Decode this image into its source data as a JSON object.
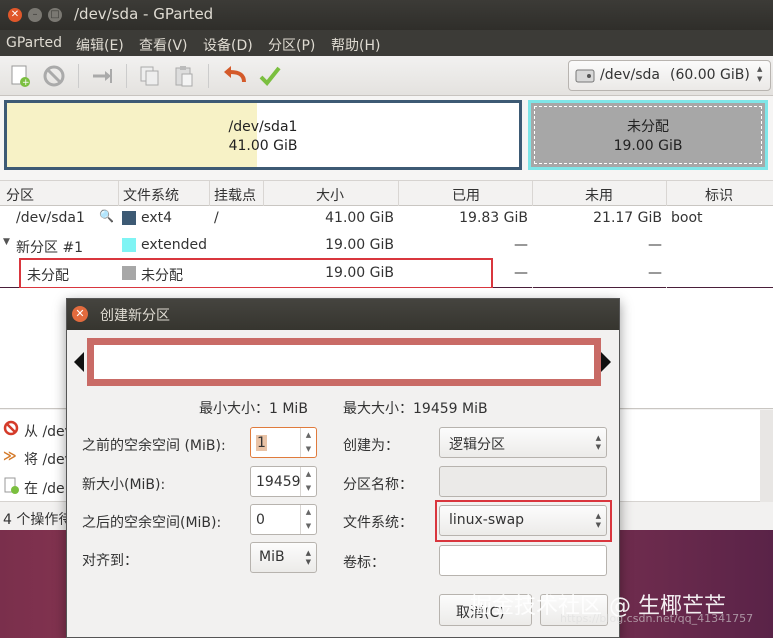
{
  "window": {
    "title": "/dev/sda - GParted"
  },
  "menubar": [
    "GParted",
    "编辑(E)",
    "查看(V)",
    "设备(D)",
    "分区(P)",
    "帮助(H)"
  ],
  "toolbar": {
    "new": "new-partition-icon",
    "delete": "delete-icon",
    "resize": "resize-icon",
    "copy": "copy-icon",
    "paste": "paste-icon",
    "undo": "undo-icon",
    "apply": "apply-icon"
  },
  "device_selector": {
    "label": "/dev/sda",
    "size": "(60.00 GiB)"
  },
  "graph": {
    "seg1_name": "/dev/sda1",
    "seg1_size": "41.00 GiB",
    "seg2_name": "未分配",
    "seg2_size": "19.00 GiB"
  },
  "table": {
    "headers": [
      "分区",
      "文件系统",
      "挂载点",
      "大小",
      "已用",
      "未用",
      "标识"
    ],
    "rows": [
      {
        "partition": "/dev/sda1",
        "fs": "ext4",
        "mount": "/",
        "size": "41.00 GiB",
        "used": "19.83 GiB",
        "unused": "21.17 GiB",
        "flags": "boot",
        "color": "#3d5a74"
      },
      {
        "partition": "新分区 #1",
        "fs": "extended",
        "mount": "",
        "size": "19.00 GiB",
        "used": "—",
        "unused": "—",
        "flags": "",
        "color": "#7ff4f4"
      },
      {
        "partition": "未分配",
        "fs": "未分配",
        "mount": "",
        "size": "19.00 GiB",
        "used": "—",
        "unused": "—",
        "flags": "",
        "color": "#a7a7a7"
      }
    ]
  },
  "ops_log": {
    "items": [
      "从 /dev",
      "将 /dev",
      "在 /de"
    ],
    "pending": "4 个操作待"
  },
  "dialog": {
    "title": "创建新分区",
    "min_size": "最小大小：1 MiB",
    "max_size": "最大大小：19459 MiB",
    "free_before_label": "之前的空余空间 (MiB):",
    "free_before_value": "1",
    "new_size_label": "新大小(MiB):",
    "new_size_value": "19459",
    "free_after_label": "之后的空余空间(MiB):",
    "free_after_value": "0",
    "align_label": "对齐到：",
    "align_value": "MiB",
    "create_as_label": "创建为：",
    "create_as_value": "逻辑分区",
    "part_name_label": "分区名称：",
    "fs_label": "文件系统：",
    "fs_value": "linux-swap",
    "vol_label_label": "卷标：",
    "cancel": "取消(C)"
  },
  "watermark": {
    "text": "掘金技术社区 @ 生椰芒芒",
    "url": "https://blog.csdn.net/qq_41341757"
  }
}
